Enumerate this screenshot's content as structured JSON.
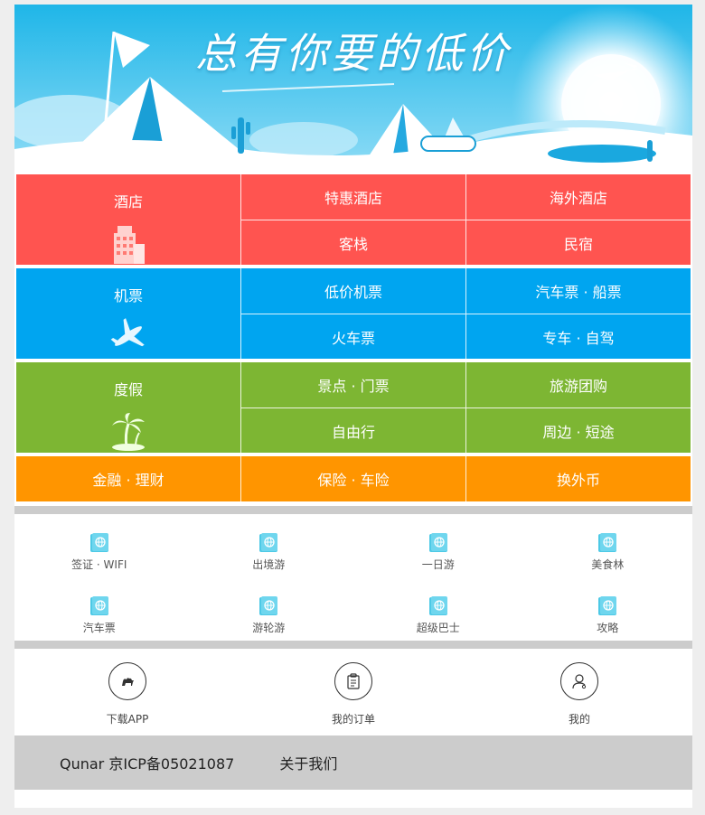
{
  "banner": {
    "title": "总有你要的低价"
  },
  "categories": {
    "hotel": {
      "main": "酒店",
      "items": [
        "特惠酒店",
        "海外酒店",
        "客栈",
        "民宿"
      ],
      "color": "#ff5450"
    },
    "flight": {
      "main": "机票",
      "items": [
        "低价机票",
        "汽车票 · 船票",
        "火车票",
        "专车 · 自驾"
      ],
      "color": "#00a5f0"
    },
    "vacation": {
      "main": "度假",
      "items": [
        "景点 · 门票",
        "旅游团购",
        "自由行",
        "周边 · 短途"
      ],
      "color": "#7db633"
    },
    "finance": {
      "items": [
        "金融 · 理财",
        "保险 · 车险",
        "换外币"
      ],
      "color": "#ff9500"
    }
  },
  "services": [
    "签证 · WIFI",
    "出境游",
    "一日游",
    "美食林",
    "汽车票",
    "游轮游",
    "超级巴士",
    "攻略"
  ],
  "nav": [
    "下载APP",
    "我的订单",
    "我的"
  ],
  "footer": {
    "icp": "Qunar 京ICP备05021087",
    "about": "关于我们"
  }
}
